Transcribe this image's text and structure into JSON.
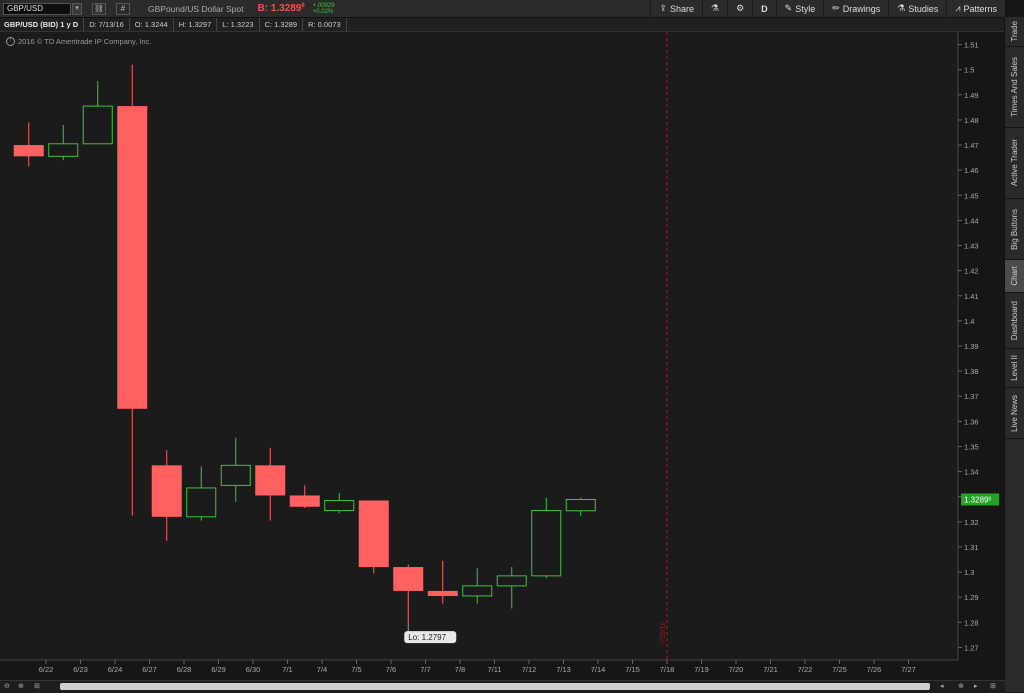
{
  "toolbar": {
    "symbol": "GBP/USD",
    "grid_icon": "#",
    "description": "GBPound/US Dollar Spot",
    "bid_label": "B: 1.3289",
    "bid_suffix": "6",
    "change_abs": "+.00029",
    "change_pct": "+0.02%",
    "buttons": [
      {
        "icon": "share-icon",
        "label": "Share"
      },
      {
        "icon": "flask-icon",
        "label": ""
      },
      {
        "icon": "gear-icon",
        "label": ""
      },
      {
        "icon": "period",
        "label": "D"
      },
      {
        "icon": "style-icon",
        "label": "Style"
      },
      {
        "icon": "pencil-icon",
        "label": "Drawings"
      },
      {
        "icon": "flask-icon",
        "label": "Studies"
      },
      {
        "icon": "patterns-icon",
        "label": "Patterns"
      }
    ]
  },
  "infobar": {
    "title": "GBP/USD (BID) 1 y D",
    "date": "D: 7/13/16",
    "open": "O: 1.3244",
    "high": "H: 1.3297",
    "low": "L: 1.3223",
    "close": "C: 1.3289",
    "range": "R: 0.0073"
  },
  "copyright": "2016 © TD Ameritrade IP Company, Inc.",
  "sidebar_tabs": [
    "Trade",
    "Times And Sales",
    "Active Trader",
    "Big Buttons",
    "Chart",
    "Dashboard",
    "Level II",
    "Live News"
  ],
  "colors": {
    "up": "#3fc23f",
    "down": "#ff6161",
    "price_tag": "#25a125"
  },
  "chart_data": {
    "type": "candlestick",
    "title": "GBP/USD (BID) 1 y D",
    "ylim": [
      1.265,
      1.515
    ],
    "yticks": [
      1.27,
      1.28,
      1.29,
      1.3,
      1.31,
      1.32,
      1.33,
      1.34,
      1.35,
      1.36,
      1.37,
      1.38,
      1.39,
      1.4,
      1.41,
      1.42,
      1.43,
      1.44,
      1.45,
      1.46,
      1.47,
      1.48,
      1.49,
      1.5,
      1.51
    ],
    "x_labels": [
      "6/22",
      "6/23",
      "6/24",
      "6/27",
      "6/28",
      "6/29",
      "6/30",
      "7/1",
      "7/4",
      "7/5",
      "7/6",
      "7/7",
      "7/8",
      "7/11",
      "7/12",
      "7/13",
      "7/14",
      "7/15",
      "7/18",
      "7/19",
      "7/20",
      "7/21",
      "7/22",
      "7/25",
      "7/26",
      "7/27"
    ],
    "candles": [
      {
        "date": "6/22",
        "o": 1.47,
        "h": 1.479,
        "l": 1.4615,
        "c": 1.4655
      },
      {
        "date": "6/23",
        "o": 1.4655,
        "h": 1.478,
        "l": 1.464,
        "c": 1.4705
      },
      {
        "date": "6/24",
        "o": 1.4705,
        "h": 1.4955,
        "l": 1.4705,
        "c": 1.4855
      },
      {
        "date": "6/27",
        "o": 1.4855,
        "h": 1.502,
        "l": 1.3225,
        "c": 1.365
      },
      {
        "date": "6/28",
        "o": 1.3425,
        "h": 1.3485,
        "l": 1.3125,
        "c": 1.322
      },
      {
        "date": "6/29",
        "o": 1.322,
        "h": 1.342,
        "l": 1.3205,
        "c": 1.3335
      },
      {
        "date": "6/30",
        "o": 1.3345,
        "h": 1.3535,
        "l": 1.328,
        "c": 1.3425
      },
      {
        "date": "7/1",
        "o": 1.3425,
        "h": 1.3495,
        "l": 1.3205,
        "c": 1.3305
      },
      {
        "date": "7/4",
        "o": 1.3305,
        "h": 1.3345,
        "l": 1.3255,
        "c": 1.326
      },
      {
        "date": "7/5",
        "o": 1.3245,
        "h": 1.3315,
        "l": 1.3235,
        "c": 1.3285
      },
      {
        "date": "7/6",
        "o": 1.3285,
        "h": 1.3285,
        "l": 1.2995,
        "c": 1.302
      },
      {
        "date": "7/7",
        "o": 1.302,
        "h": 1.303,
        "l": 1.2797,
        "c": 1.2925
      },
      {
        "date": "7/8",
        "o": 1.2925,
        "h": 1.3045,
        "l": 1.2875,
        "c": 1.2905
      },
      {
        "date": "7/11",
        "o": 1.2905,
        "h": 1.3015,
        "l": 1.2875,
        "c": 1.2945
      },
      {
        "date": "7/12",
        "o": 1.2945,
        "h": 1.302,
        "l": 1.2855,
        "c": 1.2985
      },
      {
        "date": "7/13",
        "o": 1.2985,
        "h": 1.3295,
        "l": 1.2975,
        "c": 1.3245
      },
      {
        "date": "7/14",
        "o": 1.3244,
        "h": 1.3297,
        "l": 1.3223,
        "c": 1.3289
      }
    ],
    "last_price_label": "1.3289",
    "last_price_suffix": "6",
    "last_price": 1.3289,
    "low_annotation": "Lo: 1.2797",
    "low_value": 1.2797,
    "marker_label": "7/15/16",
    "marker_date": "7/18"
  }
}
